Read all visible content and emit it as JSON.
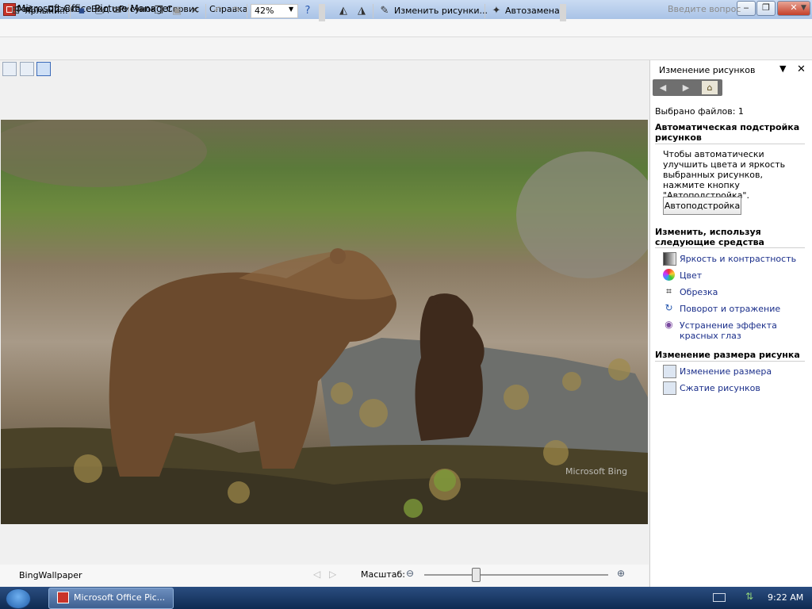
{
  "window": {
    "title": "Microsoft Office Picture Manager"
  },
  "menu": [
    "Файл",
    "Правка",
    "Вид",
    "Рисунок",
    "Сервис",
    "Справка"
  ],
  "help": {
    "placeholder": "Введите вопрос"
  },
  "toolbar": {
    "shortcuts_label": "Ярлыки...",
    "zoom_value": "42%",
    "edit_pictures_label": "Изменить рисунки...",
    "autofix_label": "Автозамена"
  },
  "status": {
    "filename": "BingWallpaper",
    "zoom_label": "Масштаб:",
    "zoom_level": 0.28
  },
  "pane": {
    "title": "Изменение рисунков",
    "files_selected": "Выбрано файлов: 1",
    "auto_section_title": "Автоматическая подстройка рисунков",
    "auto_description": "Чтобы автоматически улучшить цвета и яркость выбранных рисунков, нажмите кнопку \"Автоподстройка\".",
    "autofix_button": "Автоподстройка",
    "tools_section_title": "Изменить, используя следующие средства",
    "tools": [
      {
        "label": "Яркость и контрастность",
        "icon": "brightness-icon"
      },
      {
        "label": "Цвет",
        "icon": "color-icon"
      },
      {
        "label": "Обрезка",
        "icon": "crop-icon"
      },
      {
        "label": "Поворот и отражение",
        "icon": "rotate-icon"
      },
      {
        "label": "Устранение эффекта красных глаз",
        "icon": "red-eye-icon"
      }
    ],
    "resize_section_title": "Изменение размера рисунка",
    "resize_tools": [
      {
        "label": "Изменение размера",
        "icon": "resize-icon"
      },
      {
        "label": "Сжатие рисунков",
        "icon": "compress-icon"
      }
    ]
  },
  "photo": {
    "watermark": "Microsoft Bing"
  },
  "taskbar": {
    "window_button": "Microsoft Office Pic...",
    "clock": "9:22 AM"
  }
}
